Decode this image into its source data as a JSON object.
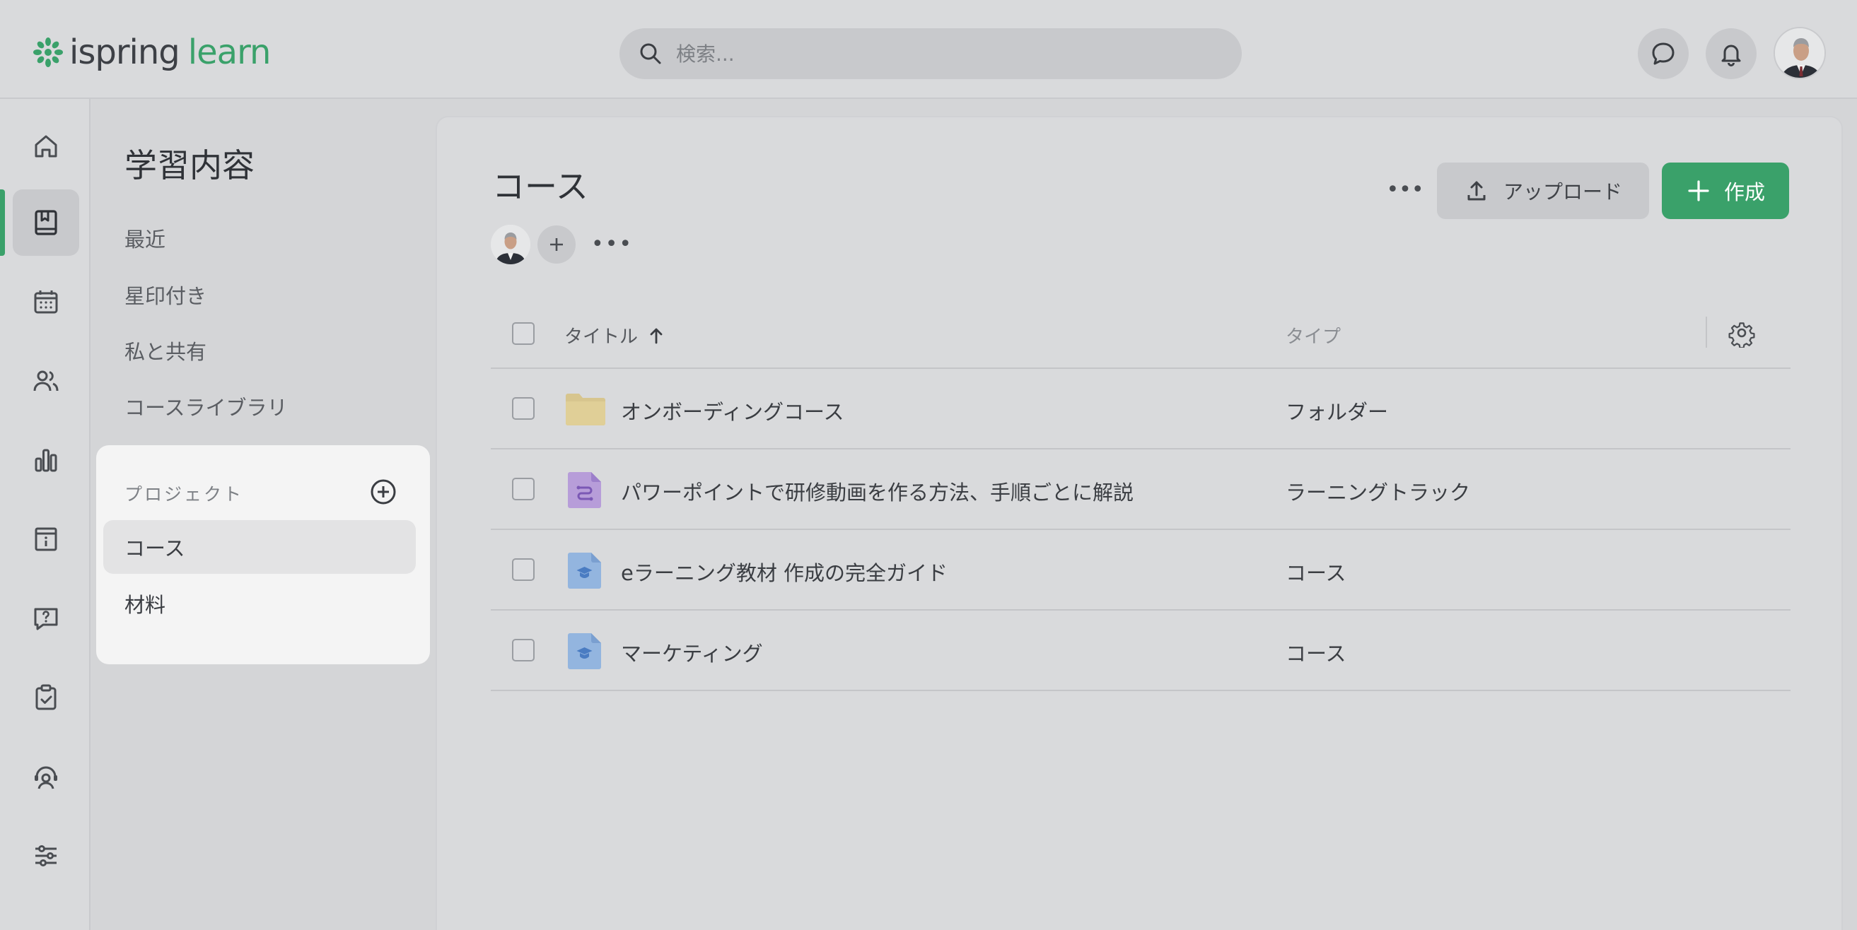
{
  "brand": {
    "part1": "ispring",
    "part2": "learn",
    "accent": "#3aa16a"
  },
  "search": {
    "placeholder": "検索..."
  },
  "sidebar": {
    "title": "学習内容",
    "links": [
      "最近",
      "星印付き",
      "私と共有",
      "コースライブラリ"
    ],
    "projects": {
      "label": "プロジェクト",
      "items": [
        {
          "label": "コース",
          "selected": true
        },
        {
          "label": "材料",
          "selected": false
        }
      ]
    }
  },
  "main": {
    "title": "コース",
    "more": "•••",
    "upload_label": "アップロード",
    "create_label": "作成",
    "table": {
      "columns": {
        "title": "タイトル",
        "type": "タイプ"
      },
      "rows": [
        {
          "icon": "folder-icon",
          "title": "オンボーディングコース",
          "type": "フォルダー"
        },
        {
          "icon": "learning-track-icon",
          "title": "パワーポイントで研修動画を作る方法、手順ごとに解説",
          "type": "ラーニングトラック"
        },
        {
          "icon": "course-icon",
          "title": "eラーニング教材 作成の完全ガイド",
          "type": "コース"
        },
        {
          "icon": "course-icon",
          "title": "マーケティング",
          "type": "コース"
        }
      ]
    }
  }
}
